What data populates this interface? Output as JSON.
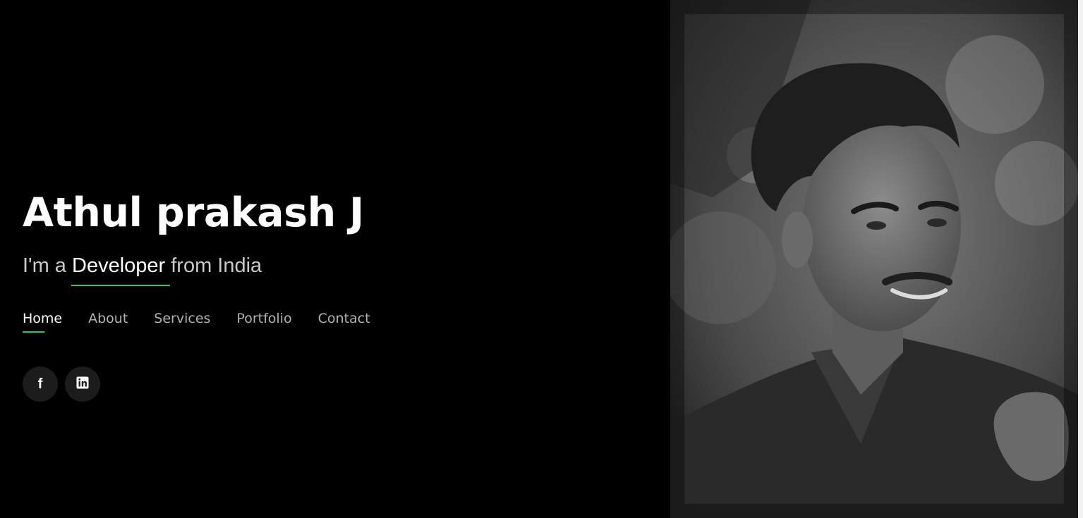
{
  "hero": {
    "name": "Athul prakash J",
    "tagline_prefix": "I'm a ",
    "tagline_role": "Developer",
    "tagline_suffix": " from India"
  },
  "nav": {
    "items": [
      {
        "label": "Home",
        "active": true
      },
      {
        "label": "About",
        "active": false
      },
      {
        "label": "Services",
        "active": false
      },
      {
        "label": "Portfolio",
        "active": false
      },
      {
        "label": "Contact",
        "active": false
      }
    ]
  },
  "social": {
    "items": [
      {
        "icon": "facebook-icon"
      },
      {
        "icon": "linkedin-icon"
      }
    ]
  },
  "colors": {
    "background": "#000000",
    "accent": "#18d26e",
    "heading": "#ffffff",
    "muted_text": "#b3b3b3"
  }
}
